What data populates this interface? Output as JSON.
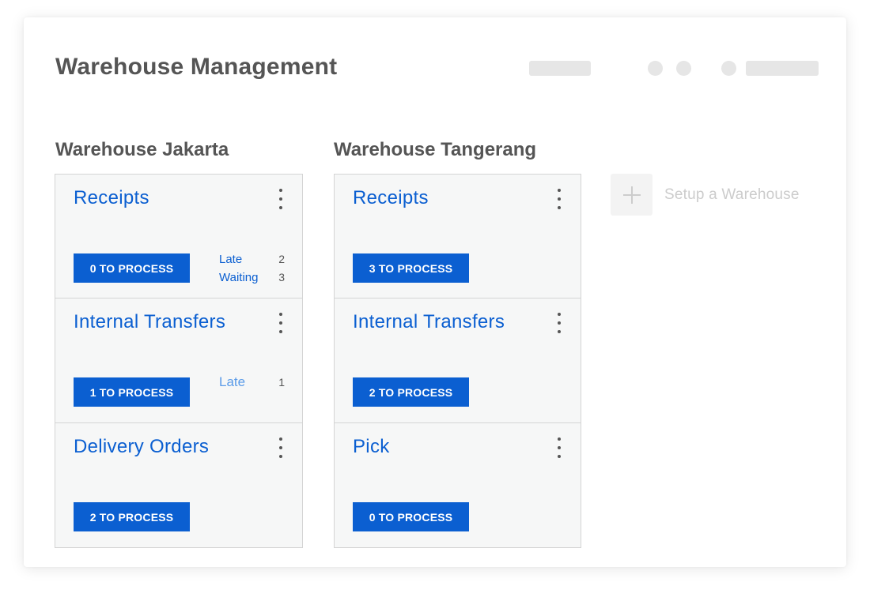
{
  "app": {
    "title": "Warehouse Management"
  },
  "warehouses": [
    {
      "name": "Warehouse Jakarta",
      "operations": [
        {
          "title": "Receipts",
          "process_label": "0 TO PROCESS",
          "stats": [
            {
              "label": "Late",
              "value": "2"
            },
            {
              "label": "Waiting",
              "value": "3"
            }
          ]
        },
        {
          "title": "Internal Transfers",
          "process_label": "1 TO PROCESS",
          "stats": [
            {
              "label": "Late",
              "value": "1"
            }
          ]
        },
        {
          "title": "Delivery Orders",
          "process_label": "2 TO PROCESS",
          "stats": []
        }
      ]
    },
    {
      "name": "Warehouse Tangerang",
      "operations": [
        {
          "title": "Receipts",
          "process_label": "3 TO PROCESS",
          "stats": []
        },
        {
          "title": "Internal Transfers",
          "process_label": "2 TO PROCESS",
          "stats": []
        },
        {
          "title": "Pick",
          "process_label": "0 TO PROCESS",
          "stats": []
        }
      ]
    }
  ],
  "setup": {
    "label": "Setup a Warehouse",
    "icon": "plus-icon"
  },
  "colors": {
    "accent": "#0b5fd1",
    "card_bg": "#f6f7f7",
    "title_text": "#555555",
    "muted": "#cccccc"
  }
}
